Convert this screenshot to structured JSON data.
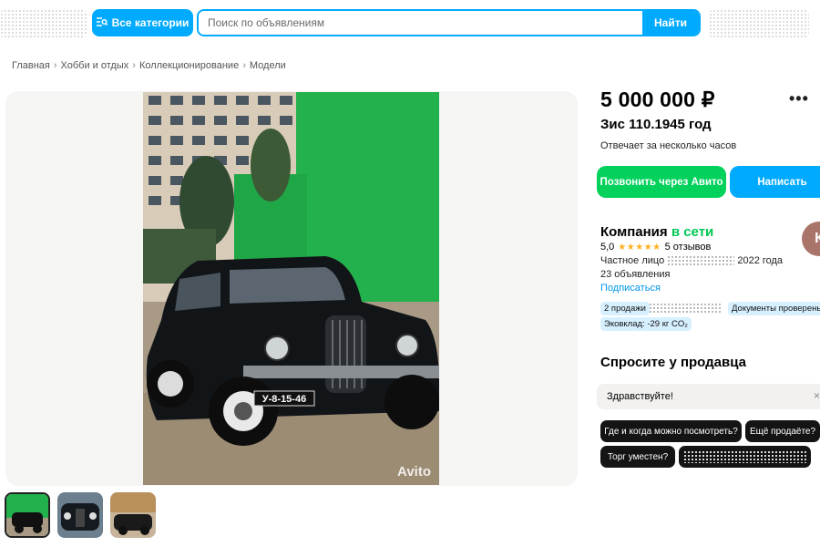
{
  "header": {
    "categories_button": "Все категории",
    "search_placeholder": "Поиск по объявлениям",
    "search_value": "",
    "find_button": "Найти"
  },
  "breadcrumbs": [
    "Главная",
    "Хобби и отдых",
    "Коллекционирование",
    "Модели"
  ],
  "gallery": {
    "main_photo": {
      "plate": "У-8-15-46",
      "watermark": "Avito"
    },
    "thumbnails": [
      "thumbnail-1",
      "thumbnail-2",
      "thumbnail-3"
    ]
  },
  "listing": {
    "price": "5 000 000 ₽",
    "title": "Зис 110.1945 год",
    "response_time": "Отвечает за несколько часов",
    "call_button": "Позвонить через Авито",
    "write_button": "Написать"
  },
  "seller": {
    "name": "Компания",
    "online": "в сети",
    "rating": "5,0",
    "reviews": "5 отзывов",
    "type_prefix": "Частное лицо",
    "since": "2022 года",
    "ads_count": "23 объявления",
    "subscribe": "Подписаться",
    "avatar_letter": "К",
    "badges": {
      "sales": "2 продажи",
      "documents": "Документы проверены",
      "eco": "Эковклад: -29 кг CO₂"
    }
  },
  "ask_seller": {
    "heading": "Спросите у продавца",
    "message": "Здравствуйте!",
    "chips": [
      "Где и когда можно посмотреть?",
      "Ещё продаёте?",
      "Торг уместен?"
    ]
  },
  "colors": {
    "accent_blue": "#00aaff",
    "green": "#02d15c",
    "online_green": "#02c754",
    "star": "#ffb021"
  }
}
